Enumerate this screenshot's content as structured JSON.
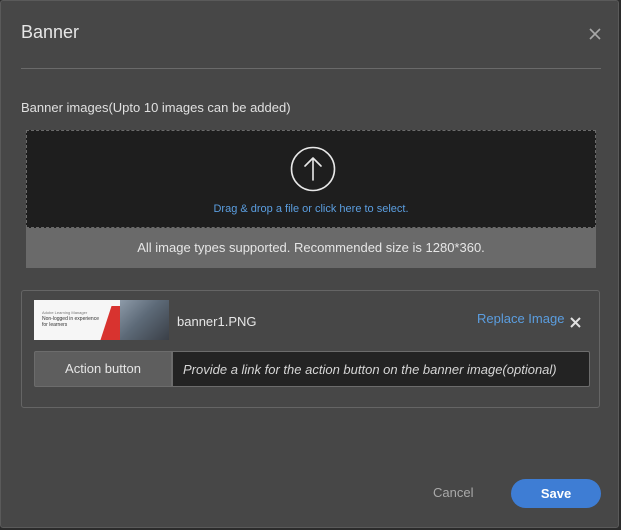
{
  "dialog": {
    "title": "Banner",
    "close_icon": "close-icon"
  },
  "upload": {
    "section_label": "Banner images(Upto 10 images can be added)",
    "upload_icon": "upload-arrow-icon",
    "dropzone_text": "Drag & drop a file or click here to select.",
    "supported_text": "All image types supported. Recommended size is 1280*360."
  },
  "item": {
    "thumbnail": {
      "small_text": "Adobe Learning Manager",
      "headline": "Non-logged in experience for learners"
    },
    "filename": "banner1.PNG",
    "replace_label": "Replace Image",
    "remove_icon": "close-icon",
    "action_label": "Action button",
    "action_value": "",
    "action_placeholder": "Provide a link for the action button on the banner image(optional)"
  },
  "footer": {
    "cancel_label": "Cancel",
    "save_label": "Save"
  },
  "colors": {
    "accent": "#3e7dd4",
    "link": "#5b9ee0",
    "dialog_bg": "#474747"
  }
}
